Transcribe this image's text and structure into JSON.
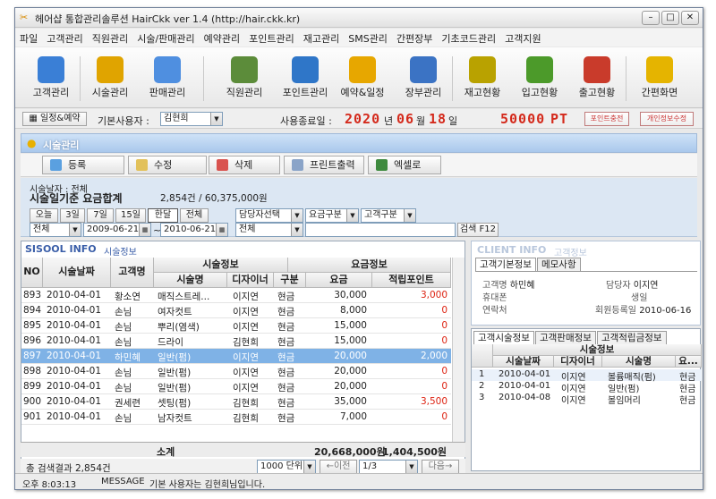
{
  "window": {
    "title": "헤어샵 통합관리솔루션 HairCkk ver 1.4 (http://hair.ckk.kr)"
  },
  "menu": [
    "파일",
    "고객관리",
    "직원관리",
    "시술/판매관리",
    "예약관리",
    "포인트관리",
    "재고관리",
    "SMS관리",
    "간편장부",
    "기초코드관리",
    "고객지원"
  ],
  "toolbar": [
    {
      "label": "고객관리",
      "icon": "customer-icon",
      "color": "#3a7fd6"
    },
    {
      "label": "시술관리",
      "icon": "scissors-icon",
      "color": "#e0a400"
    },
    {
      "label": "판매관리",
      "icon": "sales-icon",
      "color": "#4f8fe0"
    },
    {
      "label": "직원관리",
      "icon": "staff-icon",
      "color": "#5c8c3a"
    },
    {
      "label": "포인트관리",
      "icon": "point-icon",
      "color": "#2f76c8"
    },
    {
      "label": "예약&일정",
      "icon": "alarm-clock-icon",
      "color": "#e7a700"
    },
    {
      "label": "장부관리",
      "icon": "ledger-icon",
      "color": "#3b73c4"
    },
    {
      "label": "재고현황",
      "icon": "database-icon",
      "color": "#b9a200"
    },
    {
      "label": "입고현황",
      "icon": "database-in-icon",
      "color": "#4c9a2a"
    },
    {
      "label": "출고현황",
      "icon": "database-out-icon",
      "color": "#c93b2b"
    },
    {
      "label": "간편화면",
      "icon": "window-icon",
      "color": "#e5b400"
    }
  ],
  "info": {
    "schedule_btn": "일정&예약",
    "user_label": "기본사용자 :",
    "user_value": "김현희",
    "end_date_label": "사용종료일 :",
    "year": "2020",
    "year_suffix": "년",
    "month": "06",
    "month_suffix": "월",
    "day": "18",
    "day_suffix": "일",
    "points": "50000",
    "points_unit": "PT",
    "point_charge": "포인트충전",
    "personal_edit": "개인정보수정"
  },
  "section": {
    "title": "시술관리"
  },
  "actions": {
    "add": "등록",
    "edit": "수정",
    "delete": "삭제",
    "print": "프린트출력",
    "excel": "엑셀로"
  },
  "filter": {
    "date_label": "시술날자 : 전체",
    "summary_label": "시술일기준 요금합계",
    "summary_value": "2,854건 / 60,375,000원",
    "quick": [
      "오늘",
      "3일",
      "7일",
      "15일",
      "한달",
      "전체"
    ],
    "scope": "전체",
    "from": "2009-06-21",
    "to": "2010-06-21",
    "staff_select": "담당자선택",
    "fee_type": "요금구분",
    "cust_type": "고객구분",
    "staff_value": "전체",
    "search_placeholder": "",
    "search_btn": "검색 F12"
  },
  "grid": {
    "title": "SISOOL INFO",
    "subtitle": "시술정보",
    "headers": {
      "no": "NO",
      "date": "시술날짜",
      "customer": "고객명",
      "treatment_group": "시술정보",
      "treatment": "시술명",
      "designer": "디자이너",
      "type": "구분",
      "fee_group": "요금정보",
      "fee": "요금",
      "points": "적립포인트"
    },
    "rows": [
      {
        "no": "893",
        "date": "2010-04-01",
        "customer": "황소연",
        "treatment": "매직스트레...",
        "designer": "이지연",
        "type": "현금",
        "fee": "30,000",
        "points": "3,000"
      },
      {
        "no": "894",
        "date": "2010-04-01",
        "customer": "손님",
        "treatment": "여자컷트",
        "designer": "이지연",
        "type": "현금",
        "fee": "8,000",
        "points": "0"
      },
      {
        "no": "895",
        "date": "2010-04-01",
        "customer": "손님",
        "treatment": "뿌리(염색)",
        "designer": "이지연",
        "type": "현금",
        "fee": "15,000",
        "points": "0"
      },
      {
        "no": "896",
        "date": "2010-04-01",
        "customer": "손님",
        "treatment": "드라이",
        "designer": "김현희",
        "type": "현금",
        "fee": "15,000",
        "points": "0"
      },
      {
        "no": "897",
        "date": "2010-04-01",
        "customer": "하민혜",
        "treatment": "일반(펌)",
        "designer": "이지연",
        "type": "현금",
        "fee": "20,000",
        "points": "2,000"
      },
      {
        "no": "898",
        "date": "2010-04-01",
        "customer": "손님",
        "treatment": "일반(펌)",
        "designer": "이지연",
        "type": "현금",
        "fee": "20,000",
        "points": "0"
      },
      {
        "no": "899",
        "date": "2010-04-01",
        "customer": "손님",
        "treatment": "일반(펌)",
        "designer": "이지연",
        "type": "현금",
        "fee": "20,000",
        "points": "0"
      },
      {
        "no": "900",
        "date": "2010-04-01",
        "customer": "권세련",
        "treatment": "셋팅(펌)",
        "designer": "김현희",
        "type": "현금",
        "fee": "35,000",
        "points": "3,500"
      },
      {
        "no": "901",
        "date": "2010-04-01",
        "customer": "손님",
        "treatment": "남자컷트",
        "designer": "김현희",
        "type": "현금",
        "fee": "7,000",
        "points": "0"
      }
    ],
    "selected_index": 4,
    "total_label": "소계",
    "total_fee": "20,668,000원",
    "total_points": "1,404,500원",
    "result": "총 검색결과 2,854건",
    "unit": "1000 단위",
    "prev": "←이전",
    "page": "1/3",
    "next": "다음→"
  },
  "client": {
    "title": "CLIENT INFO",
    "subtitle": "고객정보",
    "tab1": "고객기본정보",
    "tab2": "메모사항",
    "name_label": "고객명",
    "name": "하민혜",
    "staff_label": "담당자",
    "staff": "이지연",
    "phone_label": "휴대폰",
    "birth_label": "생일",
    "contact_label": "연락처",
    "reg_label": "회원등록일",
    "reg_date": "2010-06-16"
  },
  "history": {
    "tabs": [
      "고객시술정보",
      "고객판매정보",
      "고객적립금정보"
    ],
    "group": "시술정보",
    "headers": {
      "date": "시술날짜",
      "designer": "디자이너",
      "treatment": "시술명",
      "extra": "요..."
    },
    "rows": [
      {
        "no": "1",
        "date": "2010-04-01",
        "designer": "이지연",
        "treatment": "볼륨매직(펌)",
        "extra": "현금"
      },
      {
        "no": "2",
        "date": "2010-04-01",
        "designer": "이지연",
        "treatment": "일반(펌)",
        "extra": "현금"
      },
      {
        "no": "3",
        "date": "2010-04-08",
        "designer": "이지연",
        "treatment": "볼임머리",
        "extra": "현금"
      }
    ]
  },
  "status": {
    "time": "오후 8:03:13",
    "label": "MESSAGE",
    "message": "기본 사용자는 김현희님입니다."
  }
}
